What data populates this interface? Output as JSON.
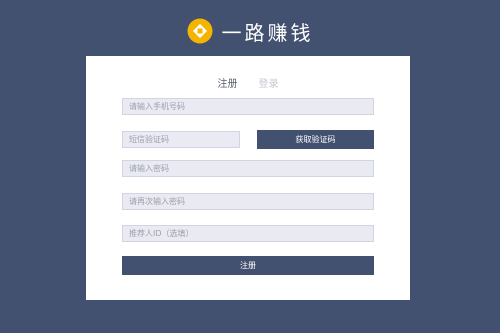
{
  "brand": {
    "name": "一路赚钱",
    "logo_icon": "gold-coin-icon",
    "logo_color": "#f5b400"
  },
  "form": {
    "tabs": [
      {
        "label": "注册",
        "active": true
      },
      {
        "label": "登录",
        "active": false
      }
    ],
    "phone_placeholder": "请输入手机号码",
    "sms_code_placeholder": "短信验证码",
    "get_code_label": "获取验证码",
    "password_placeholder": "请输入密码",
    "confirm_password_placeholder": "请再次输入密码",
    "referrer_placeholder": "推荐人ID（选填）",
    "submit_label": "注册"
  },
  "colors": {
    "background": "#425170",
    "button": "#425170",
    "input_bg": "#eaeaf3"
  }
}
